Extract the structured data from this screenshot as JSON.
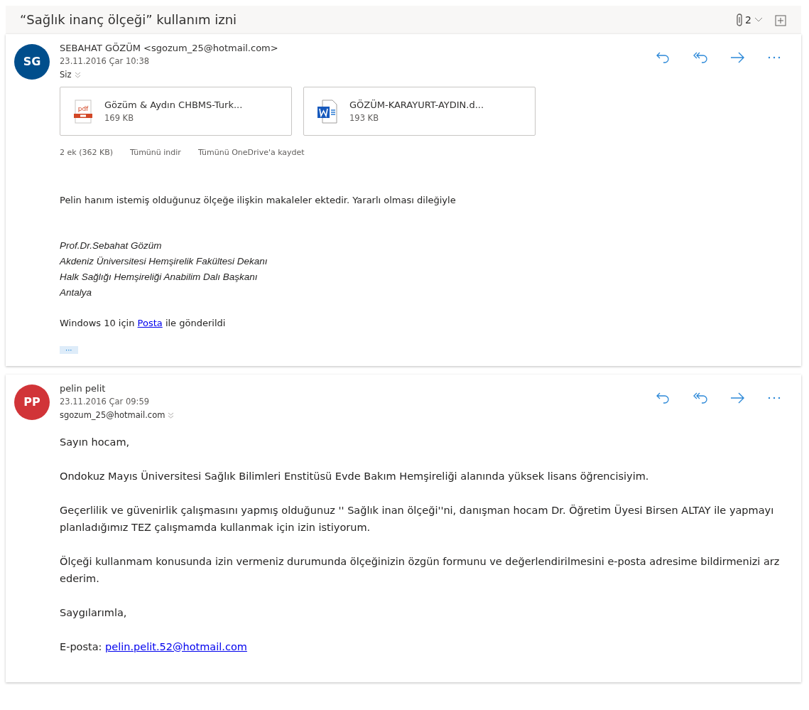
{
  "subject": "“Sağlık inanç ölçeği” kullanım izni",
  "header": {
    "attachment_count": "2"
  },
  "messages": [
    {
      "initials": "SG",
      "color": "#004e8c",
      "sender": "SEBAHAT GÖZÜM <sgozum_25@hotmail.com>",
      "date": "23.11.2016 Çar 10:38",
      "recipient": "Siz",
      "attachments": [
        {
          "kind": "pdf",
          "name": "Gözüm & Aydın CHBMS-Turk...",
          "size": "169 KB"
        },
        {
          "kind": "word",
          "name": "GÖZÜM-KARAYURT-AYDIN.d...",
          "size": "193 KB"
        }
      ],
      "attachment_summary": "2 ek (362 KB)",
      "attachment_actions": [
        "Tümünü indir",
        "Tümünü OneDrive'a kaydet"
      ],
      "body": [
        {
          "kind": "text",
          "text": "Pelin hanım istemiş olduğunuz ölçeğe ilişkin makaleler ektedir. Yararlı olması dileğiyle"
        },
        {
          "kind": "signature",
          "lines": [
            "Prof.Dr.Sebahat Gözüm",
            "Akdeniz Üniversitesi Hemşirelik Fakültesi Dekanı",
            "Halk Sağlığı Hemşireliği Anabilim Dalı Başkanı",
            "Antalya"
          ]
        },
        {
          "kind": "link",
          "before": "Windows 10 için ",
          "link": "Posta",
          "after": " ile gönderildi"
        },
        {
          "kind": "more",
          "text": "···"
        }
      ]
    },
    {
      "initials": "PP",
      "color": "#d13438",
      "sender": "pelin pelit",
      "date": "23.11.2016 Çar 09:59",
      "recipient": "sgozum_25@hotmail.com",
      "body": [
        {
          "kind": "text",
          "text": "Sayın hocam,"
        },
        {
          "kind": "text",
          "text": "Ondokuz Mayıs Üniversitesi Sağlık Bilimleri Enstitüsü Evde Bakım Hemşireliği alanında yüksek lisans öğrencisiyim."
        },
        {
          "kind": "text",
          "text": "Geçerlilik ve güvenirlik çalışmasını yapmış olduğunuz '' Sağlık inan ölçeği''ni, danışman hocam Dr. Öğretim Üyesi Birsen ALTAY  ile yapmayı planladığımız TEZ çalışmamda kullanmak için izin istiyorum."
        },
        {
          "kind": "text",
          "text": "Ölçeği kullanmam konusunda izin vermeniz durumunda ölçeğinizin özgün formunu ve değerlendirilmesini e-posta adresime  bildirmenizi arz ederim."
        },
        {
          "kind": "text",
          "text": "Saygılarımla,"
        },
        {
          "kind": "link",
          "before": "E-posta: ",
          "link": "pelin.pelit.52@hotmail.com"
        }
      ]
    }
  ]
}
